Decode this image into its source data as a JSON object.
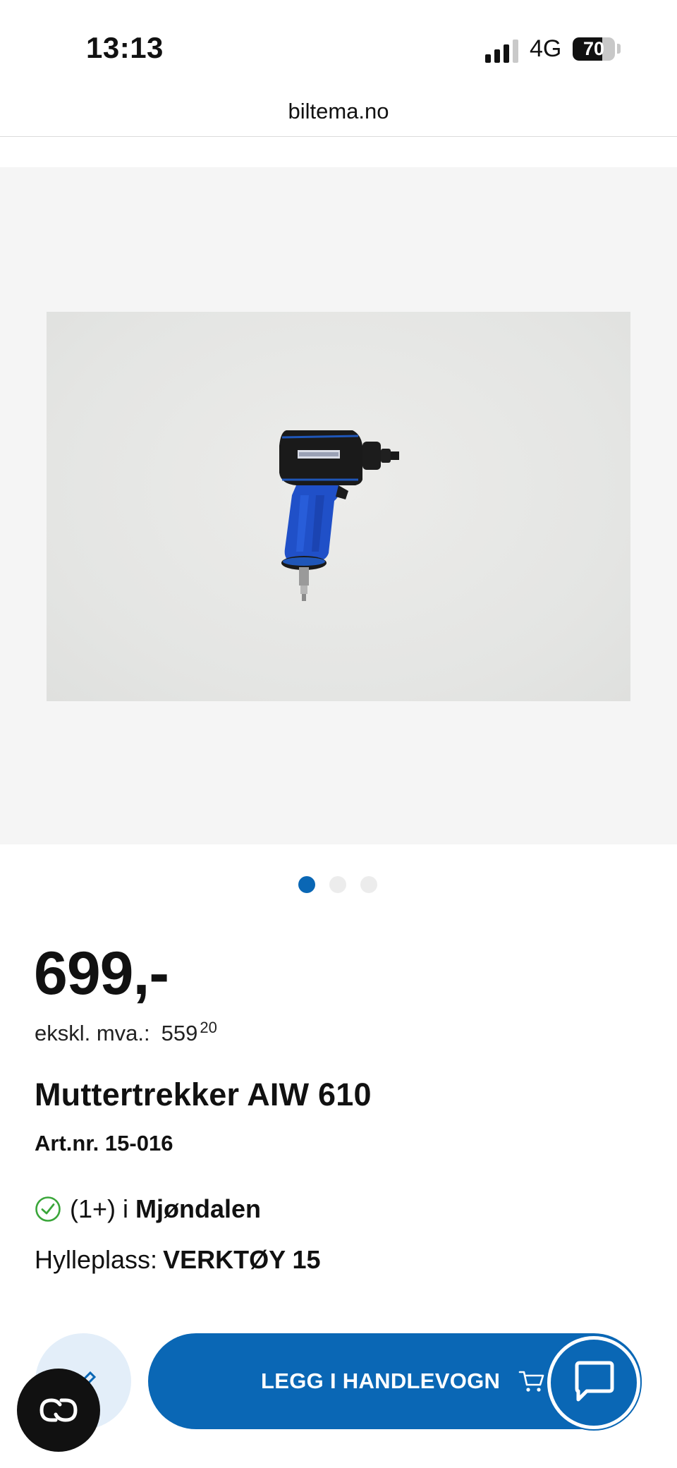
{
  "status_bar": {
    "time": "13:13",
    "network": "4G",
    "battery": "70",
    "battery_level": 0.7
  },
  "browser": {
    "url": "biltema.no"
  },
  "gallery": {
    "image_count": 3,
    "active_index": 0,
    "image_alt": "Muttertrekker AIW 610 product photo"
  },
  "product": {
    "price": "699,-",
    "vat_label": "ekskl. mva.:",
    "vat_int": "559",
    "vat_dec": "20",
    "name": "Muttertrekker AIW 610",
    "article_number": "Art.nr. 15-016",
    "stock_count": "(1+) i",
    "store": "Mjøndalen",
    "shelf_label": "Hylleplass:",
    "shelf_value": "VERKTØY 15"
  },
  "actions": {
    "add_to_cart": "LEGG I HANDLEVOGN"
  },
  "colors": {
    "brand_blue": "#0a67b5",
    "check_green": "#3aa63a",
    "gallery_bg": "#f5f5f5"
  },
  "icons": [
    "signal-icon",
    "battery-icon",
    "check-circle-icon",
    "favorite-icon",
    "cart-icon",
    "chat-icon",
    "co-badge-icon"
  ]
}
